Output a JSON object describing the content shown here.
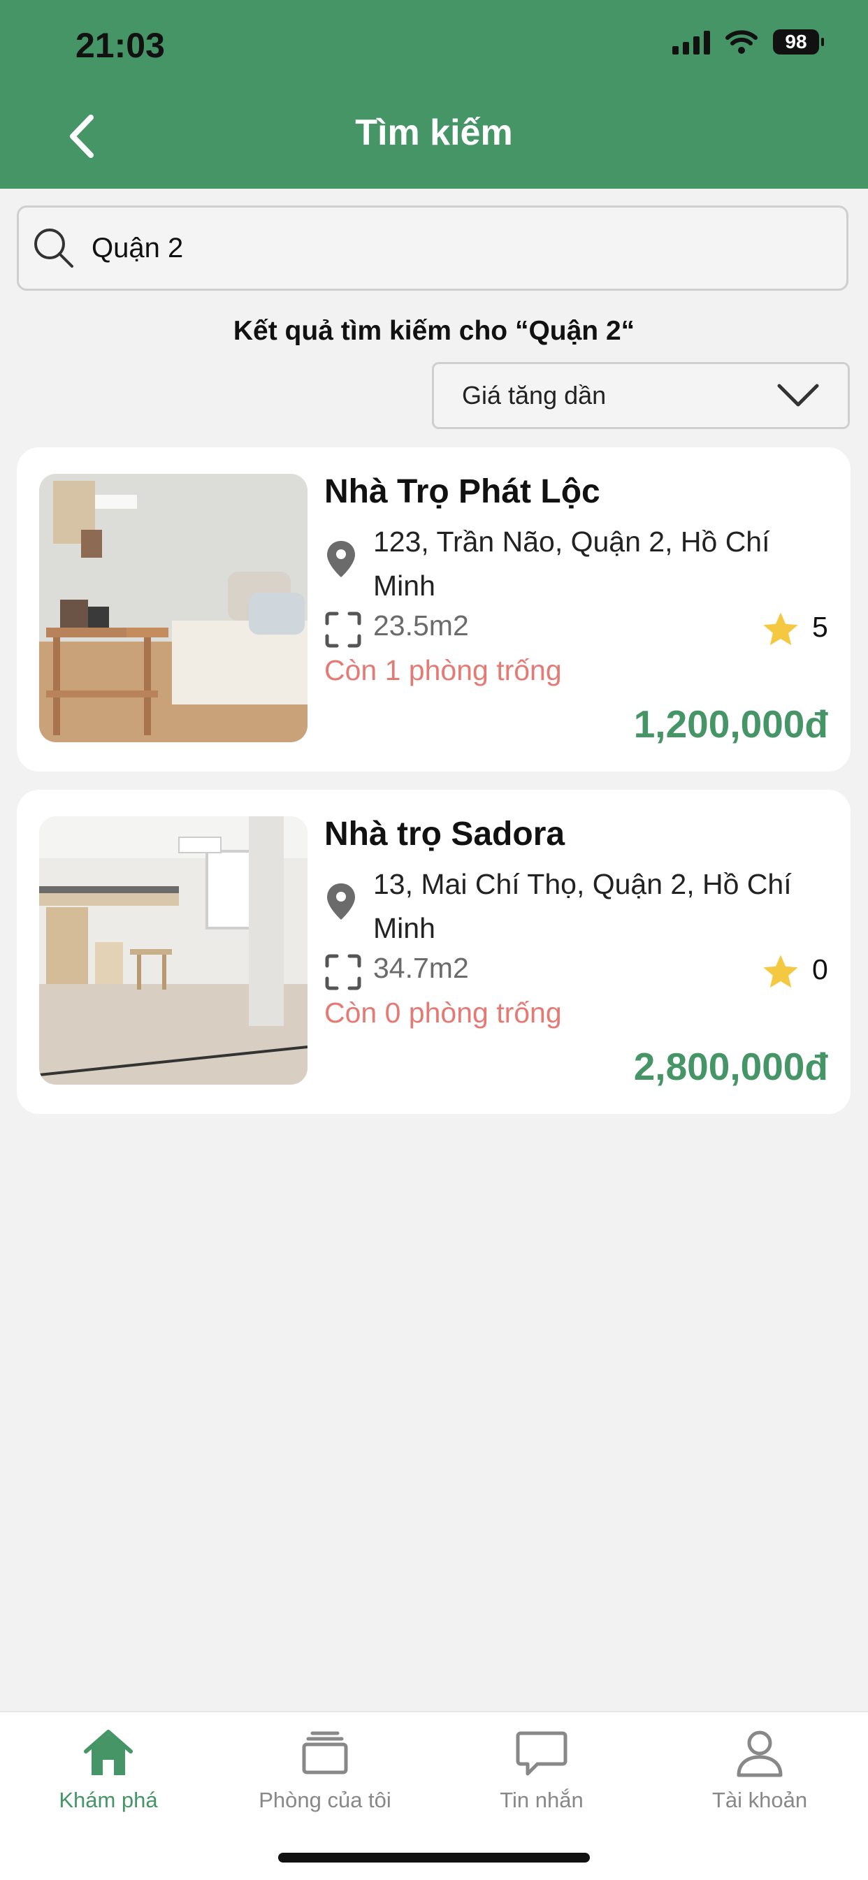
{
  "status_bar": {
    "time": "21:03",
    "battery": "98"
  },
  "header": {
    "title": "Tìm kiếm"
  },
  "search": {
    "value": "Quận 2"
  },
  "results": {
    "heading": "Kết quả tìm kiếm cho “Quận 2“"
  },
  "sort": {
    "selected": "Giá tăng dần"
  },
  "listings": [
    {
      "title": "Nhà Trọ Phát Lộc",
      "address": "123, Trần Não, Quận 2, Hồ Chí Minh",
      "area": "23.5m2",
      "rating": "5",
      "availability": "Còn 1 phòng trống",
      "price": "1,200,000đ"
    },
    {
      "title": "Nhà trọ Sadora",
      "address": "13, Mai Chí Thọ, Quận 2, Hồ Chí Minh",
      "area": "34.7m2",
      "rating": "0",
      "availability": "Còn 0 phòng trống",
      "price": "2,800,000đ"
    }
  ],
  "tabbar": {
    "items": [
      {
        "label": "Khám phá",
        "icon": "home-icon",
        "active": true
      },
      {
        "label": "Phòng của tôi",
        "icon": "rooms-icon",
        "active": false
      },
      {
        "label": "Tin nhắn",
        "icon": "chat-icon",
        "active": false
      },
      {
        "label": "Tài khoản",
        "icon": "user-icon",
        "active": false
      }
    ]
  },
  "colors": {
    "brand": "#459567",
    "availability": "#e57a74",
    "star": "#f5c842"
  }
}
